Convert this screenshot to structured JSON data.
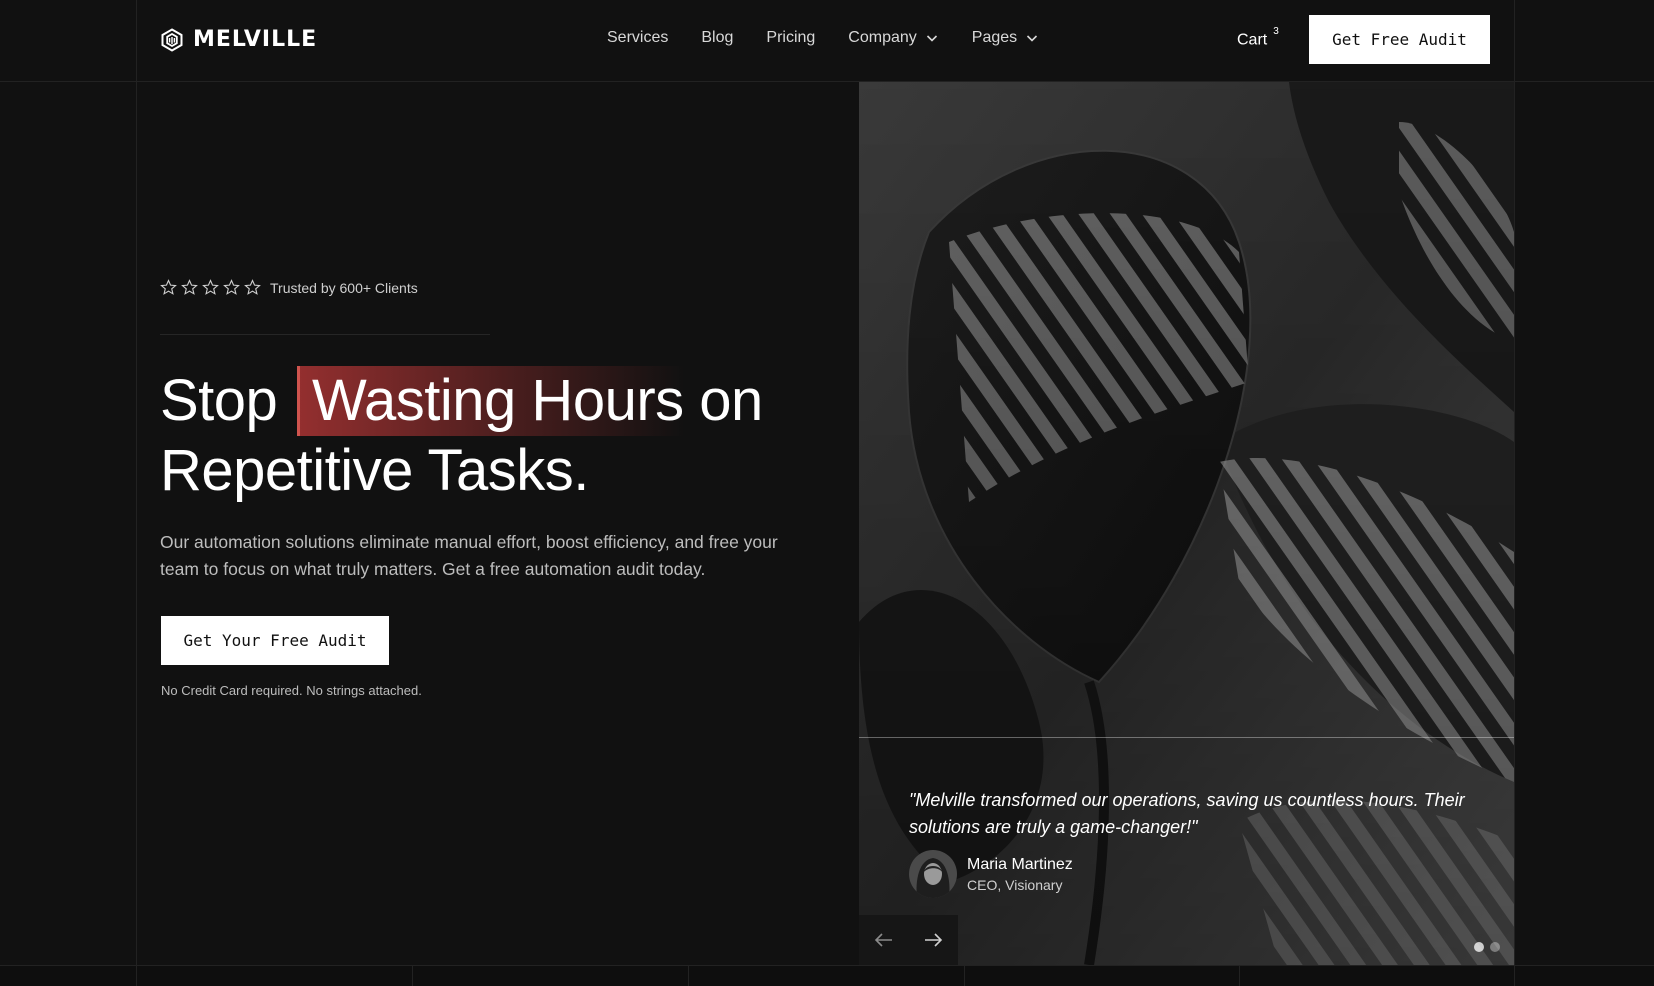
{
  "brand": {
    "name": "MELVILLE",
    "logo_icon": "hexagon-cube-icon"
  },
  "nav": {
    "items": [
      {
        "label": "Services"
      },
      {
        "label": "Blog"
      },
      {
        "label": "Pricing"
      },
      {
        "label": "Company",
        "dropdown": true
      },
      {
        "label": "Pages",
        "dropdown": true
      }
    ],
    "cart_label": "Cart",
    "cart_count": "3",
    "cta_label": "Get Free Audit"
  },
  "hero": {
    "rating_stars": 5,
    "rating_text": "Trusted by 600+ Clients",
    "headline_part1": "Stop",
    "headline_highlight": "Wasting Hours",
    "headline_part2": "on",
    "headline_line2": "Repetitive Tasks.",
    "subtext": "Our automation solutions eliminate manual effort, boost efficiency, and free your team to focus on what truly matters. Get a free automation audit today.",
    "cta_label": "Get Your Free Audit",
    "note": "No Credit Card required. No strings attached.",
    "highlight_color": "#c24a45"
  },
  "testimonial": {
    "quote": "\"Melville transformed our operations, saving us countless hours. Their solutions are truly a game-changer!\"",
    "author_name": "Maria Martinez",
    "author_role": "CEO, Visionary",
    "slides": 2,
    "active_slide": 1
  }
}
